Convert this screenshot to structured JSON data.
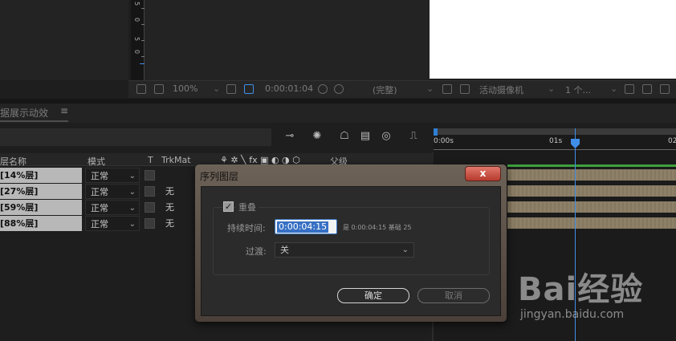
{
  "viewer": {
    "ruler_ticks": [
      "5",
      "0",
      "5",
      "0"
    ],
    "zoom": "100%",
    "timecode": "0:00:01:04",
    "resolution": "(完整)",
    "camera": "活动摄像机",
    "views": "1 个..."
  },
  "timeline": {
    "panel_title": "据展示动效",
    "menu_icon": "≡",
    "time_labels": [
      "0:00s",
      "01s",
      "02"
    ],
    "columns": {
      "source_name": "层名称",
      "mode": "模式",
      "t": "T",
      "trkmat": "TrkMat",
      "parent": "父级"
    },
    "layers": [
      {
        "name": "[14%层]",
        "mode": "正常",
        "trkmat": ""
      },
      {
        "name": "[27%层]",
        "mode": "正常",
        "trkmat": "无"
      },
      {
        "name": "[59%层]",
        "mode": "正常",
        "trkmat": "无"
      },
      {
        "name": "[88%层]",
        "mode": "正常",
        "trkmat": "无"
      }
    ]
  },
  "dialog": {
    "title": "序列图层",
    "close_label": "x",
    "overlap_label": "重叠",
    "overlap_checked": true,
    "duration_label": "持续时间:",
    "duration_value": "0:00:04:15",
    "duration_info": "是 0:00:04:15  基础 25",
    "transition_label": "过渡:",
    "transition_value": "关",
    "ok_label": "确定",
    "cancel_label": "取消"
  },
  "watermark": {
    "logo": "Bai经验",
    "url": "jingyan.baidu.com"
  },
  "colors": {
    "accent_blue": "#3f8fe8",
    "layer_bar": "#8a7d63",
    "green_bar": "#3ea03e"
  }
}
